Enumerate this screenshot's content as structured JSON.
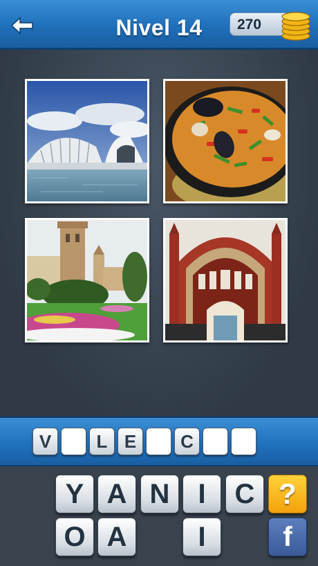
{
  "header": {
    "title": "Nivel 14",
    "coins": "270",
    "back_icon": "arrow-left-icon",
    "coin_icon": "coin-stack-icon"
  },
  "puzzle": {
    "images": [
      "city-of-arts-and-sciences-photo",
      "paella-photo",
      "cathedral-garden-photo",
      "market-gate-photo"
    ],
    "answer_slots": [
      "V",
      "",
      "L",
      "E",
      "",
      "C",
      "",
      ""
    ]
  },
  "keyboard": {
    "row1": [
      "Y",
      "A",
      "N",
      "I",
      "C"
    ],
    "row2": [
      "O",
      "A",
      "",
      "I",
      ""
    ],
    "help_label": "?",
    "facebook_label": "f"
  },
  "colors": {
    "accent_blue": "#1f6fba",
    "help_orange": "#f4a10c",
    "facebook_blue": "#3a5a98"
  }
}
